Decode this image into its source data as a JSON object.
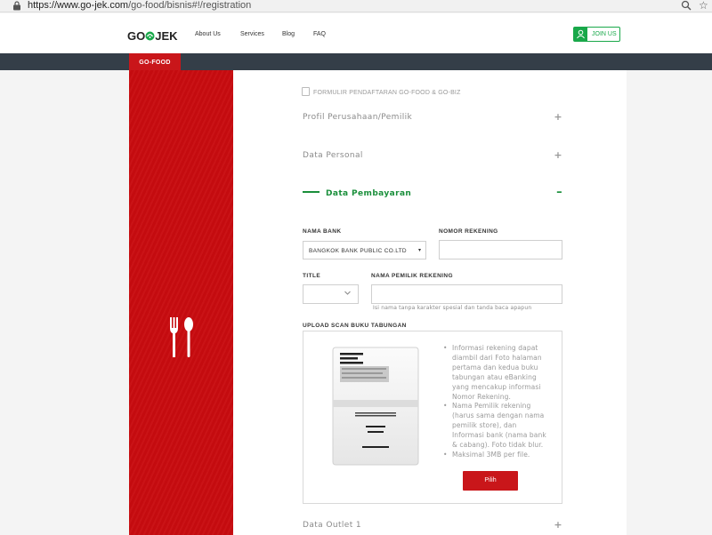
{
  "browser": {
    "url_prefix": "https://www.go-jek.com",
    "url_path": "/go-food/bisnis#!/registration"
  },
  "header": {
    "logo_text_left": "GO",
    "logo_text_right": "JEK",
    "nav": [
      "About Us",
      "Services",
      "Blog",
      "FAQ"
    ],
    "join_label": "JOIN US",
    "brand_green": "#19a84a"
  },
  "tab": {
    "label": "GO-FOOD",
    "color": "#c9161a"
  },
  "form": {
    "title": "FORMULIR PENDAFTARAN GO-FOOD & GO-BIZ",
    "sections": [
      {
        "label": "Profil Perusahaan/Pemilik",
        "state": "collapsed"
      },
      {
        "label": "Data Personal",
        "state": "collapsed"
      },
      {
        "label": "Data Pembayaran",
        "state": "expanded"
      },
      {
        "label": "Data Outlet 1",
        "state": "collapsed"
      }
    ],
    "fields": {
      "bank_label": "NAMA BANK",
      "bank_value": "BANGKOK BANK PUBLIC CO.LTD",
      "account_number_label": "NOMOR REKENING",
      "account_number_value": "",
      "title_label": "TITLE",
      "title_value": "",
      "account_name_label": "NAMA PEMILIK REKENING",
      "account_name_value": "",
      "account_name_hint": "Isi nama tanpa karakter spesial dan tanda baca apapun"
    },
    "upload": {
      "label": "UPLOAD SCAN BUKU TABUNGAN",
      "bullets": [
        "Informasi rekening dapat diambil dari Foto halaman pertama dan kedua buku tabungan atau eBanking yang mencakup informasi Nomor Rekening.",
        "Nama Pemilik rekening (harus sama dengan nama pemilik store), dan Informasi bank (nama bank & cabang). Foto tidak blur.",
        "Maksimal 3MB per file."
      ],
      "button_label": "Pilih"
    }
  }
}
